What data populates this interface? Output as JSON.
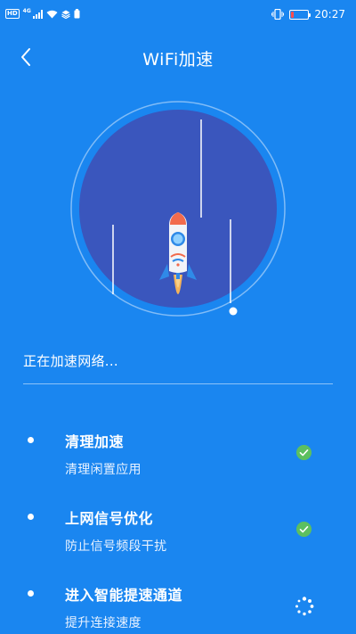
{
  "status_bar": {
    "hd": "HD",
    "network": "4G",
    "time": "20:27",
    "battery_level": 0.18,
    "battery_color": "#ff4d4d"
  },
  "header": {
    "title": "WiFi加速",
    "back_icon": "chevron-left-icon"
  },
  "accelerator": {
    "status_text": "正在加速网络...",
    "rocket_icon": "rocket-icon",
    "colors": {
      "background": "#1a86f0",
      "circle": "#3a56bd",
      "flame": "#f4b35a",
      "rocket_tip": "#f26b4d"
    }
  },
  "tasks": [
    {
      "title": "清理加速",
      "subtitle": "清理闲置应用",
      "state": "done",
      "icon": "check-circle-icon"
    },
    {
      "title": "上网信号优化",
      "subtitle": "防止信号频段干扰",
      "state": "done",
      "icon": "check-circle-icon"
    },
    {
      "title": "进入智能提速通道",
      "subtitle": "提升连接速度",
      "state": "loading",
      "icon": "loading-spinner-icon"
    }
  ],
  "check_color": "#5cbf60"
}
